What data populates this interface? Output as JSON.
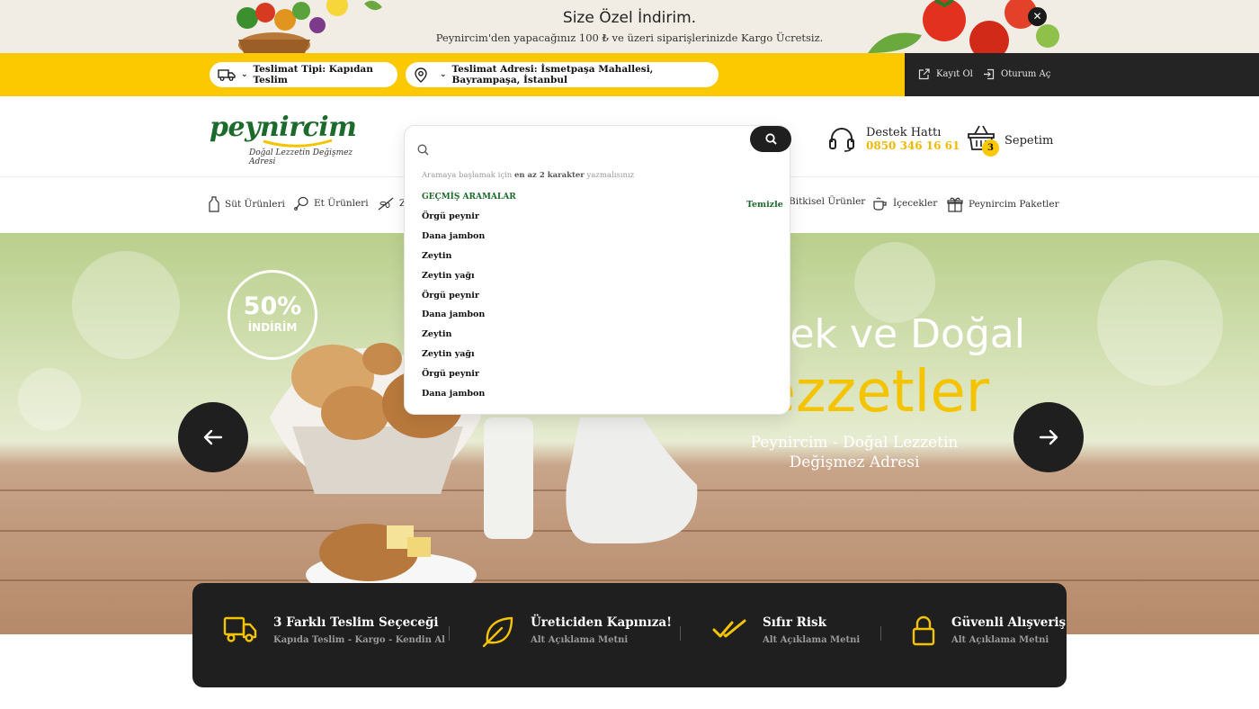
{
  "promo": {
    "title": "Size Özel İndirim.",
    "subtitle": "Peynircim'den yapacağınız 100 ₺ ve üzeri siparişlerinizde Kargo Ücretsiz.",
    "close_label": "✕"
  },
  "topbar": {
    "delivery_type": "Teslimat Tipi: Kapıdan Teslim",
    "delivery_address": "Teslimat Adresi: İsmetpaşa Mahallesi, Bayrampaşa, İstanbul",
    "register": "Kayıt Ol",
    "login": "Oturum Aç"
  },
  "header": {
    "logo_word": "peynircim",
    "logo_tagline": "Doğal Lezzetin Değişmez Adresi",
    "support_label": "Destek Hattı",
    "support_phone": "0850 346 16 61",
    "cart_label": "Sepetim",
    "cart_count": "3"
  },
  "nav": {
    "items": [
      "Süt Ürünleri",
      "Et Ürünleri",
      "Z",
      "Bitkisel Ürünler",
      "İçecekler",
      "Peynircim Paketler"
    ]
  },
  "search": {
    "placeholder": "",
    "hint_pre": "Aramaya başlamak için ",
    "hint_bold": "en az 2 karakter",
    "hint_post": " yazmalısınız",
    "history_title": "GEÇMİŞ ARAMALAR",
    "clear_label": "Temizle",
    "history": [
      "Örgü peynir",
      "Dana jambon",
      "Zeytin",
      "Zeytin yağı",
      "Örgü peynir",
      "Dana jambon",
      "Zeytin",
      "Zeytin yağı",
      "Örgü peynir",
      "Dana jambon"
    ]
  },
  "hero": {
    "discount_value": "50%",
    "discount_label": "İNDİRİM",
    "line1": "ek ve Doğal",
    "line2": "ezzetler",
    "sub1": "Peynircim - Doğal Lezzetin",
    "sub2": "Değişmez Adresi"
  },
  "features": [
    {
      "title": "3 Farklı Teslim Seçeceği",
      "sub": "Kapıda Teslim - Kargo - Kendin Al",
      "icon": "truck-icon"
    },
    {
      "title": "Üreticiden Kapınıza!",
      "sub": "Alt Açıklama Metni",
      "icon": "leaf-icon"
    },
    {
      "title": "Sıfır Risk",
      "sub": "Alt Açıklama Metni",
      "icon": "double-check-icon"
    },
    {
      "title": "Güvenli Alışveriş",
      "sub": "Alt Açıklama Metni",
      "icon": "lock-icon"
    }
  ],
  "colors": {
    "brand_green": "#1c6b2c",
    "accent_yellow": "#fcc900",
    "dark": "#1f1f1f"
  }
}
